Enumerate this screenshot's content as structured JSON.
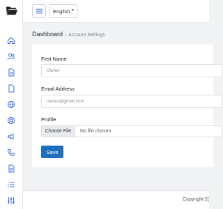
{
  "sidebar": {
    "logo_icon": "folder-open-icon",
    "items": [
      {
        "icon": "home-icon"
      },
      {
        "icon": "users-icon"
      },
      {
        "icon": "document-icon"
      },
      {
        "icon": "file-icon"
      },
      {
        "icon": "globe-icon"
      },
      {
        "icon": "support-icon"
      },
      {
        "icon": "megaphone-icon"
      },
      {
        "icon": "phone-icon"
      },
      {
        "icon": "page-icon"
      },
      {
        "icon": "list-icon"
      },
      {
        "icon": "sliders-icon"
      }
    ]
  },
  "topbar": {
    "menu_icon": "hamburger-icon",
    "language": "English"
  },
  "breadcrumb": {
    "root": "Dashboard",
    "separator": "/",
    "current": "Account Settings"
  },
  "form": {
    "first_name_label": "First Name",
    "first_name_placeholder": "Owner",
    "email_label": "Email Address",
    "email_placeholder": "owner@gmail.com",
    "profile_label": "Profile",
    "file_button": "Choose File",
    "file_status": "No file chosen",
    "save_label": "Save"
  },
  "footer": {
    "text": "Copyright 2("
  },
  "colors": {
    "primary": "#1f6fbf",
    "sidebar_icon": "#3b6fd6",
    "background": "#f2f3f5"
  }
}
